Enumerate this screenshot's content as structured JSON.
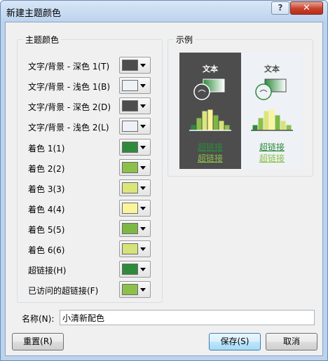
{
  "window": {
    "title": "新建主题颜色",
    "help_label": "?",
    "close_label": "✕"
  },
  "theme_colors": {
    "legend": "主题颜色",
    "rows": [
      {
        "label": "文字/背景 - 深色 1(T)",
        "color": "#4d4d4d"
      },
      {
        "label": "文字/背景 - 浅色 1(B)",
        "color": "#eef1f5"
      },
      {
        "label": "文字/背景 - 深色 2(D)",
        "color": "#4d4d4d"
      },
      {
        "label": "文字/背景 - 浅色 2(L)",
        "color": "#eef1f5"
      },
      {
        "label": "着色 1(1)",
        "color": "#2f8a3c"
      },
      {
        "label": "着色 2(2)",
        "color": "#8cc04b"
      },
      {
        "label": "着色 3(3)",
        "color": "#dbe67a"
      },
      {
        "label": "着色 4(4)",
        "color": "#faf59a"
      },
      {
        "label": "着色 5(5)",
        "color": "#7cb843"
      },
      {
        "label": "着色 6(6)",
        "color": "#d6e27a"
      },
      {
        "label": "超链接(H)",
        "color": "#2f8a3c"
      },
      {
        "label": "已访问的超链接(F)",
        "color": "#8cc04b"
      }
    ]
  },
  "sample": {
    "legend": "示例",
    "word": "文本",
    "hyperlink": "超链接",
    "visited_hyperlink": "超链接",
    "dark_bg": "#4d4d4d",
    "light_bg": "#eef1f5",
    "bar_colors": [
      "#2f8a3c",
      "#8cc04b",
      "#dbe67a",
      "#faf59a",
      "#7cb843",
      "#d6e27a",
      "#8cc04b"
    ]
  },
  "name_field": {
    "label": "名称(N):",
    "value": "小清新配色"
  },
  "buttons": {
    "reset": "重置(R)",
    "save": "保存(S)",
    "cancel": "取消"
  }
}
